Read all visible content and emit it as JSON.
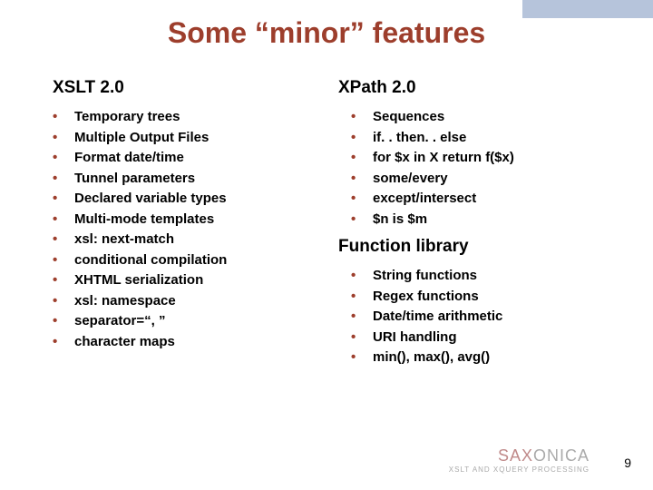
{
  "title": "Some “minor” features",
  "columns": {
    "left": {
      "heading": "XSLT 2.0",
      "items": [
        "Temporary trees",
        "Multiple Output Files",
        "Format date/time",
        "Tunnel parameters",
        "Declared variable types",
        "Multi-mode templates",
        "xsl: next-match",
        "conditional compilation",
        "XHTML serialization",
        "xsl: namespace",
        "separator=“, ”",
        "character maps"
      ]
    },
    "right": {
      "sections": [
        {
          "heading": "XPath 2.0",
          "items": [
            "Sequences",
            "if. . then. . else",
            "for $x in X return f($x)",
            "some/every",
            "except/intersect",
            "$n is $m"
          ]
        },
        {
          "heading": "Function library",
          "items": [
            "String functions",
            "Regex functions",
            "Date/time arithmetic",
            "URI handling",
            "min(), max(), avg()"
          ]
        }
      ]
    }
  },
  "footer": {
    "logo_left": "SAX",
    "logo_right": "ONICA",
    "logo_sub": "XSLT AND XQUERY PROCESSING",
    "page_number": "9"
  }
}
